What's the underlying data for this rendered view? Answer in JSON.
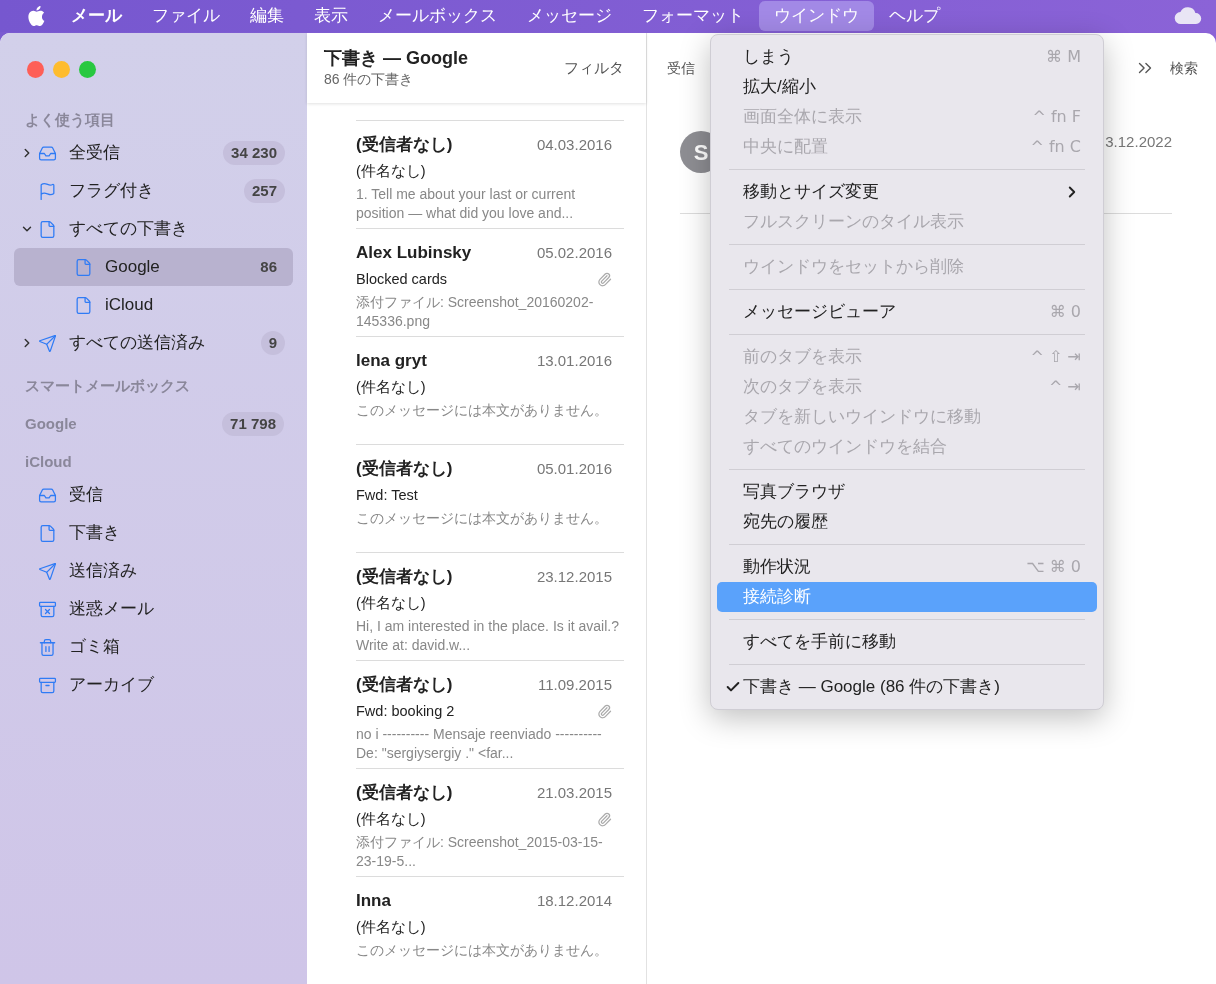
{
  "menubar": {
    "items": [
      {
        "label": "メール",
        "bold": true,
        "selected": false
      },
      {
        "label": "ファイル",
        "bold": false,
        "selected": false
      },
      {
        "label": "編集",
        "bold": false,
        "selected": false
      },
      {
        "label": "表示",
        "bold": false,
        "selected": false
      },
      {
        "label": "メールボックス",
        "bold": false,
        "selected": false
      },
      {
        "label": "メッセージ",
        "bold": false,
        "selected": false
      },
      {
        "label": "フォーマット",
        "bold": false,
        "selected": false
      },
      {
        "label": "ウインドウ",
        "bold": false,
        "selected": true
      },
      {
        "label": "ヘルプ",
        "bold": false,
        "selected": false
      }
    ]
  },
  "sidebar": {
    "sections": [
      {
        "title": "よく使う項目",
        "items": [
          {
            "label": "全受信",
            "kind": "inbox-full",
            "count": "34 230",
            "expanded": false,
            "selected": false
          },
          {
            "label": "フラグ付き",
            "kind": "flag",
            "count": "257",
            "selected": false
          },
          {
            "label": "すべての下書き",
            "kind": "document",
            "expanded": true,
            "selected": false,
            "children": [
              {
                "label": "Google",
                "kind": "document",
                "count": "86",
                "selected": true
              },
              {
                "label": "iCloud",
                "kind": "document",
                "selected": false
              }
            ]
          },
          {
            "label": "すべての送信済み",
            "kind": "sent",
            "count": "9",
            "expanded": false,
            "selected": false
          }
        ]
      },
      {
        "title": "スマートメールボックス"
      },
      {
        "title": "Google",
        "count": "71 798"
      },
      {
        "title": "iCloud",
        "items": [
          {
            "label": "受信",
            "kind": "inbox",
            "selected": false
          },
          {
            "label": "下書き",
            "kind": "document",
            "selected": false
          },
          {
            "label": "送信済み",
            "kind": "sent",
            "selected": false
          },
          {
            "label": "迷惑メール",
            "kind": "junk",
            "selected": false
          },
          {
            "label": "ゴミ箱",
            "kind": "trash",
            "selected": false
          },
          {
            "label": "アーカイブ",
            "kind": "archive",
            "selected": false
          }
        ]
      }
    ]
  },
  "message_list": {
    "title": "下書き — Google",
    "subtitle": "86 件の下書き",
    "filter": "フィルタ",
    "messages": [
      {
        "sender": "(受信者なし)",
        "date": "04.03.2016",
        "subject": "(件名なし)",
        "preview": "1. Tell me about your last or current position — what did you love and...",
        "attachment": false
      },
      {
        "sender": "Alex Lubinsky",
        "date": "05.02.2016",
        "subject": "Blocked cards",
        "preview": "添付ファイル: Screenshot_20160202-145336.png",
        "attachment": true
      },
      {
        "sender": "lena gryt",
        "date": "13.01.2016",
        "subject": "(件名なし)",
        "preview": "このメッセージには本文がありません。",
        "attachment": false
      },
      {
        "sender": "(受信者なし)",
        "date": "05.01.2016",
        "subject": "Fwd: Test",
        "preview": "このメッセージには本文がありません。",
        "attachment": false
      },
      {
        "sender": "(受信者なし)",
        "date": "23.12.2015",
        "subject": "(件名なし)",
        "preview": "Hi, I am interested in the place. Is it avail.? Write at: david.w...",
        "attachment": false
      },
      {
        "sender": "(受信者なし)",
        "date": "11.09.2015",
        "subject": "Fwd: booking 2",
        "preview": "no i ---------- Mensaje reenviado ---------- De: \"sergiysergiy .\" <far...",
        "attachment": true
      },
      {
        "sender": "(受信者なし)",
        "date": "21.03.2015",
        "subject": "(件名なし)",
        "preview": "添付ファイル: Screenshot_2015-03-15-23-19-5...",
        "attachment": true
      },
      {
        "sender": "Inna",
        "date": "18.12.2014",
        "subject": "(件名なし)",
        "preview": "このメッセージには本文がありません。",
        "attachment": false
      }
    ]
  },
  "preview": {
    "mailbox": "受信",
    "search": "検索",
    "avatar": "S",
    "date": "3.12.2022"
  },
  "menu": {
    "items": [
      {
        "kind": "item",
        "label": "しまう",
        "shortcut": "⌘ M",
        "disabled": false,
        "selected": false,
        "checked": false,
        "submenu": false
      },
      {
        "kind": "item",
        "label": "拡大/縮小",
        "disabled": false,
        "selected": false,
        "checked": false,
        "submenu": false
      },
      {
        "kind": "item",
        "label": "画面全体に表示",
        "shortcut": "^ fn F",
        "disabled": true,
        "selected": false,
        "checked": false,
        "submenu": false
      },
      {
        "kind": "item",
        "label": "中央に配置",
        "shortcut": "^ fn C",
        "disabled": true,
        "selected": false,
        "checked": false,
        "submenu": false
      },
      {
        "kind": "separator"
      },
      {
        "kind": "item",
        "label": "移動とサイズ変更",
        "disabled": false,
        "selected": false,
        "checked": false,
        "submenu": true
      },
      {
        "kind": "item",
        "label": "フルスクリーンのタイル表示",
        "disabled": true,
        "selected": false,
        "checked": false,
        "submenu": false
      },
      {
        "kind": "separator"
      },
      {
        "kind": "item",
        "label": "ウインドウをセットから削除",
        "disabled": true,
        "selected": false,
        "checked": false,
        "submenu": false
      },
      {
        "kind": "separator"
      },
      {
        "kind": "item",
        "label": "メッセージビューア",
        "shortcut": "⌘ 0",
        "disabled": false,
        "selected": false,
        "checked": false,
        "submenu": false
      },
      {
        "kind": "separator"
      },
      {
        "kind": "item",
        "label": "前のタブを表示",
        "shortcut": "^ ⇧ ⇥",
        "disabled": true,
        "selected": false,
        "checked": false,
        "submenu": false
      },
      {
        "kind": "item",
        "label": "次のタブを表示",
        "shortcut": "^ ⇥",
        "disabled": true,
        "selected": false,
        "checked": false,
        "submenu": false
      },
      {
        "kind": "item",
        "label": "タブを新しいウインドウに移動",
        "disabled": true,
        "selected": false,
        "checked": false,
        "submenu": false
      },
      {
        "kind": "item",
        "label": "すべてのウインドウを結合",
        "disabled": true,
        "selected": false,
        "checked": false,
        "submenu": false
      },
      {
        "kind": "separator"
      },
      {
        "kind": "item",
        "label": "写真ブラウザ",
        "disabled": false,
        "selected": false,
        "checked": false,
        "submenu": false
      },
      {
        "kind": "item",
        "label": "宛先の履歴",
        "disabled": false,
        "selected": false,
        "checked": false,
        "submenu": false
      },
      {
        "kind": "separator"
      },
      {
        "kind": "item",
        "label": "動作状況",
        "shortcut": "⌥ ⌘ 0",
        "disabled": false,
        "selected": false,
        "checked": false,
        "submenu": false
      },
      {
        "kind": "item",
        "label": "接続診断",
        "disabled": false,
        "selected": true,
        "checked": false,
        "submenu": false
      },
      {
        "kind": "separator"
      },
      {
        "kind": "item",
        "label": "すべてを手前に移動",
        "disabled": false,
        "selected": false,
        "checked": false,
        "submenu": false
      },
      {
        "kind": "separator"
      },
      {
        "kind": "item",
        "label": "下書き — Google (86 件の下書き)",
        "disabled": false,
        "selected": false,
        "checked": true,
        "submenu": false
      }
    ]
  }
}
